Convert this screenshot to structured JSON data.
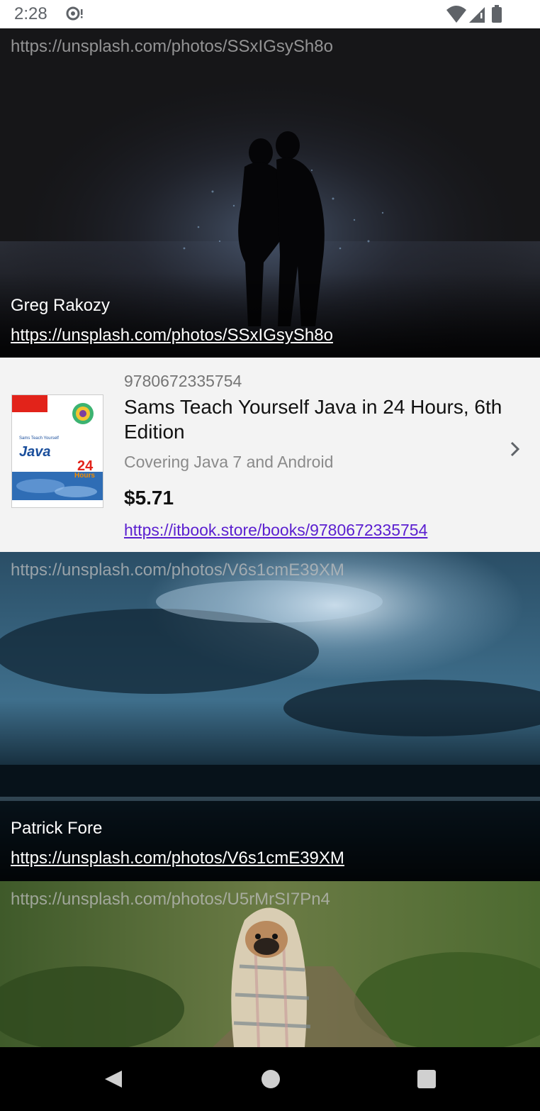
{
  "status_bar": {
    "time": "2:28",
    "icons": [
      "sync-icon",
      "wifi-icon",
      "signal-icon",
      "battery-icon"
    ]
  },
  "cards": [
    {
      "top_url": "https://unsplash.com/photos/SSxIGsySh8o",
      "author": "Greg Rakozy",
      "link": "https://unsplash.com/photos/SSxIGsySh8o"
    },
    {
      "isbn": "9780672335754",
      "title": "Sams Teach Yourself Java in 24 Hours, 6th Edition",
      "subtitle": "Covering Java 7 and Android",
      "price": "$5.71",
      "url": "https://itbook.store/books/9780672335754",
      "cover": {
        "series": "Sams Teach Yourself",
        "name": "Java",
        "number": "24",
        "unit": "Hours",
        "publisher": "SAMS"
      }
    },
    {
      "top_url": "https://unsplash.com/photos/V6s1cmE39XM",
      "author": "Patrick Fore",
      "link": "https://unsplash.com/photos/V6s1cmE39XM"
    },
    {
      "top_url": "https://unsplash.com/photos/U5rMrSI7Pn4"
    }
  ],
  "nav_bar": {
    "buttons": [
      "back-icon",
      "home-icon",
      "recents-icon"
    ]
  }
}
